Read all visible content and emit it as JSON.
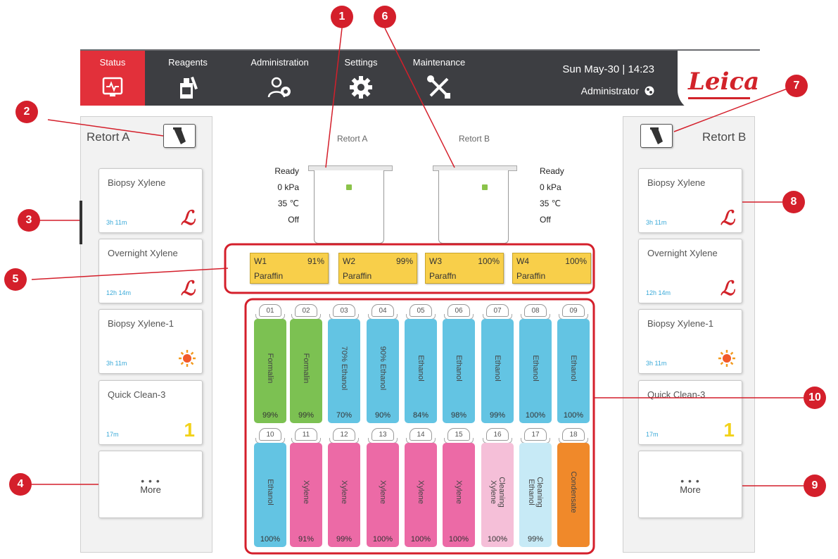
{
  "nav": {
    "tabs": [
      {
        "label": "Status",
        "icon": "status-monitor-icon"
      },
      {
        "label": "Reagents",
        "icon": "reagent-bottle-icon"
      },
      {
        "label": "Administration",
        "icon": "users-admin-icon"
      },
      {
        "label": "Settings",
        "icon": "gear-icon"
      },
      {
        "label": "Maintenance",
        "icon": "tools-icon"
      }
    ],
    "datetime": "Sun May-30 | 14:23",
    "user": "Administrator",
    "logo": "Leica",
    "accent_color": "#e2303a"
  },
  "left_panel": {
    "title": "Retort A",
    "protocols": [
      {
        "name": "Biopsy Xylene",
        "duration": "3h 11m",
        "icon": "leica-l-icon"
      },
      {
        "name": "Overnight Xylene",
        "duration": "12h 14m",
        "icon": "leica-l-icon"
      },
      {
        "name": "Biopsy Xylene-1",
        "duration": "3h 11m",
        "icon": "sun-icon"
      },
      {
        "name": "Quick Clean-3",
        "duration": "17m",
        "icon": "number-one-icon"
      }
    ],
    "more_dots": "• • •",
    "more_label": "More"
  },
  "right_panel": {
    "title": "Retort B",
    "protocols": [
      {
        "name": "Biopsy Xylene",
        "duration": "3h 11m",
        "icon": "leica-l-icon"
      },
      {
        "name": "Overnight Xylene",
        "duration": "12h 14m",
        "icon": "leica-l-icon"
      },
      {
        "name": "Biopsy Xylene-1",
        "duration": "3h 11m",
        "icon": "sun-icon"
      },
      {
        "name": "Quick Clean-3",
        "duration": "17m",
        "icon": "number-one-icon"
      }
    ],
    "more_dots": "• • •",
    "more_label": "More"
  },
  "retorts": {
    "a": {
      "label": "Retort A",
      "status": "Ready",
      "pressure": "0 kPa",
      "temperature": "35 ℃",
      "agitator": "Off"
    },
    "b": {
      "label": "Retort B",
      "status": "Ready",
      "pressure": "0 kPa",
      "temperature": "35 ℃",
      "agitator": "Off"
    }
  },
  "wax_baths": [
    {
      "id": "W1",
      "percent": "91%",
      "name": "Paraffin"
    },
    {
      "id": "W2",
      "percent": "99%",
      "name": "Paraffin"
    },
    {
      "id": "W3",
      "percent": "100%",
      "name": "Paraffn"
    },
    {
      "id": "W4",
      "percent": "100%",
      "name": "Paraffin"
    }
  ],
  "bottles": [
    {
      "num": "01",
      "name": "Formalin",
      "percent": "99%",
      "color": "#7cc152"
    },
    {
      "num": "02",
      "name": "Formalin",
      "percent": "99%",
      "color": "#7cc152"
    },
    {
      "num": "03",
      "name": "70% Ethanol",
      "percent": "70%",
      "color": "#63c4e3"
    },
    {
      "num": "04",
      "name": "90% Ethanol",
      "percent": "90%",
      "color": "#63c4e3"
    },
    {
      "num": "05",
      "name": "Ethanol",
      "percent": "84%",
      "color": "#63c4e3"
    },
    {
      "num": "06",
      "name": "Ethanol",
      "percent": "98%",
      "color": "#63c4e3"
    },
    {
      "num": "07",
      "name": "Ethanol",
      "percent": "99%",
      "color": "#63c4e3"
    },
    {
      "num": "08",
      "name": "Ethanol",
      "percent": "100%",
      "color": "#63c4e3"
    },
    {
      "num": "09",
      "name": "Ethanol",
      "percent": "100%",
      "color": "#63c4e3"
    },
    {
      "num": "10",
      "name": "Ethanol",
      "percent": "100%",
      "color": "#63c4e3"
    },
    {
      "num": "11",
      "name": "Xylene",
      "percent": "91%",
      "color": "#ec6aa6"
    },
    {
      "num": "12",
      "name": "Xylene",
      "percent": "99%",
      "color": "#ec6aa6"
    },
    {
      "num": "13",
      "name": "Xylene",
      "percent": "100%",
      "color": "#ec6aa6"
    },
    {
      "num": "14",
      "name": "Xylene",
      "percent": "100%",
      "color": "#ec6aa6"
    },
    {
      "num": "15",
      "name": "Xylene",
      "percent": "100%",
      "color": "#ec6aa6"
    },
    {
      "num": "16",
      "name": "Cleaning Xylene",
      "percent": "100%",
      "color": "#f5bfd8"
    },
    {
      "num": "17",
      "name": "Cleaning Ethanol",
      "percent": "99%",
      "color": "#c7eaf6"
    },
    {
      "num": "18",
      "name": "Condensate",
      "percent": "",
      "color": "#f0892a"
    }
  ],
  "callouts": [
    "1",
    "2",
    "3",
    "4",
    "5",
    "6",
    "7",
    "8",
    "9",
    "10"
  ],
  "callout_color": "#d41f2b"
}
